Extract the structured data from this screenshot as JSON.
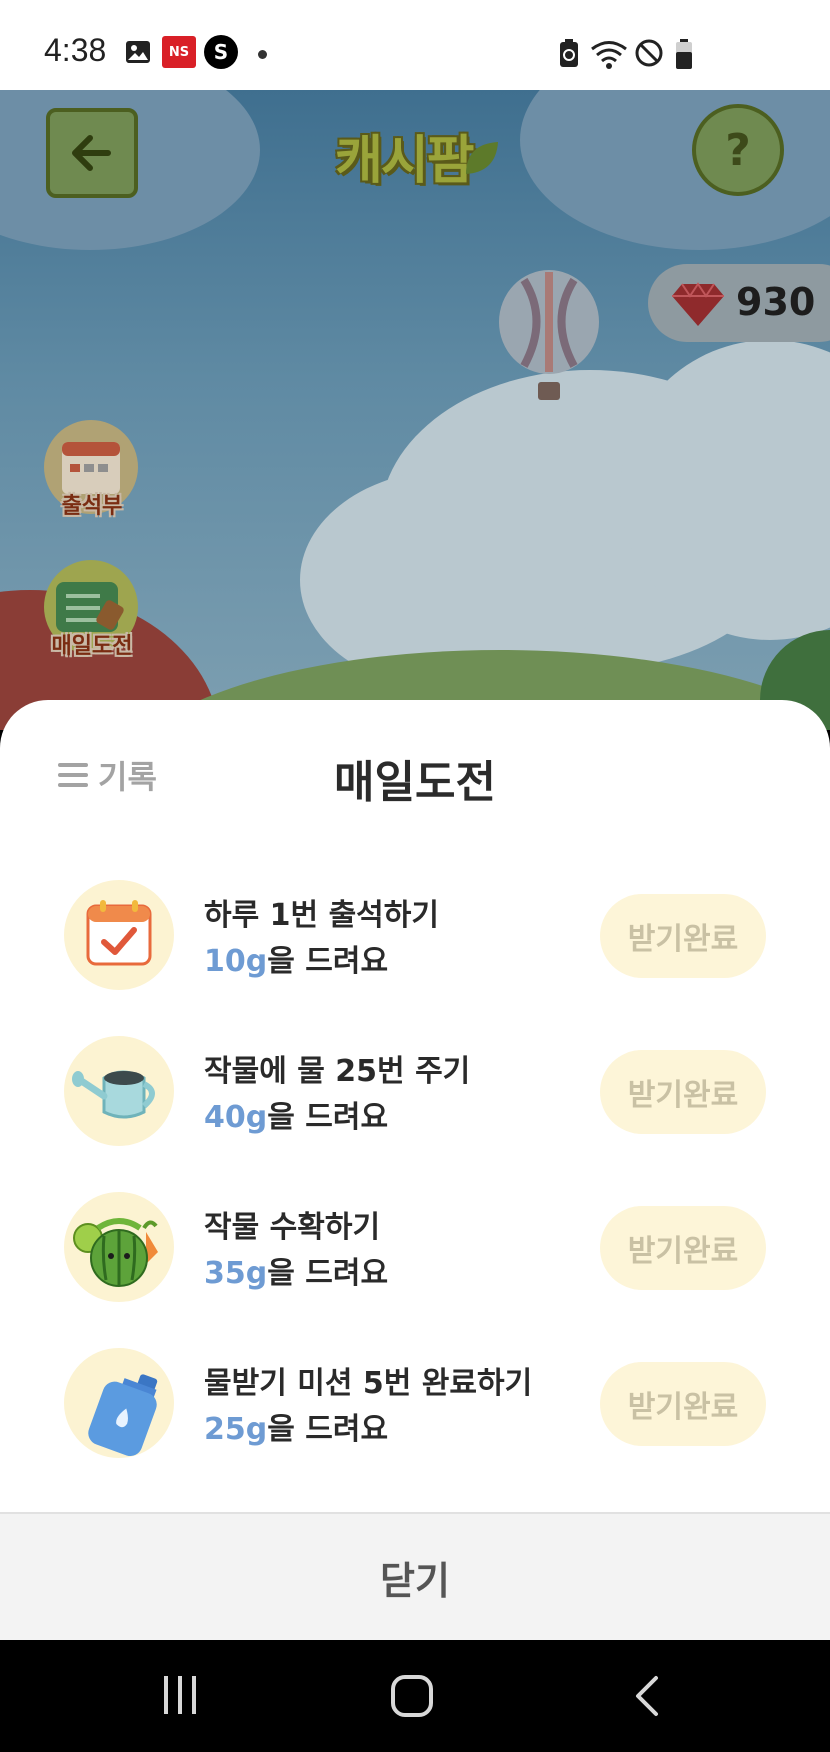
{
  "status_bar": {
    "time": "4:38",
    "left_icons": [
      "gallery-icon",
      "ns-app-icon",
      "s-app-icon",
      "notification-dot"
    ],
    "right_icons": [
      "battery-saver-icon",
      "wifi-icon",
      "do-not-disturb-icon",
      "battery-icon"
    ],
    "ns_label": "NS",
    "s_label": "S"
  },
  "game": {
    "logo_text": "캐시팜",
    "help_label": "?",
    "gem_count": "930",
    "side_buttons": [
      {
        "label": "출석부",
        "icon": "calendar-icon"
      },
      {
        "label": "매일도전",
        "icon": "checklist-icon"
      }
    ]
  },
  "sheet": {
    "history_label": "기록",
    "title": "매일도전",
    "missions": [
      {
        "title": "하루 1번 출석하기",
        "amount": "10g",
        "reward_suffix": "을 드려요",
        "button": "받기완료",
        "icon": "calendar-check-icon"
      },
      {
        "title": "작물에 물 25번 주기",
        "amount": "40g",
        "reward_suffix": "을 드려요",
        "button": "받기완료",
        "icon": "watering-can-icon"
      },
      {
        "title": "작물 수확하기",
        "amount": "35g",
        "reward_suffix": "을 드려요",
        "button": "받기완료",
        "icon": "crops-icon"
      },
      {
        "title": "물받기 미션 5번 완료하기",
        "amount": "25g",
        "reward_suffix": "을 드려요",
        "button": "받기완료",
        "icon": "water-bottle-icon"
      }
    ],
    "close_label": "닫기"
  },
  "colors": {
    "reward_amount": "#6e9bd3",
    "completed_button_bg": "#fdf5d8",
    "completed_button_text": "#c9c1a4"
  },
  "nav_bar": [
    "recent-apps-icon",
    "home-icon",
    "back-icon"
  ]
}
